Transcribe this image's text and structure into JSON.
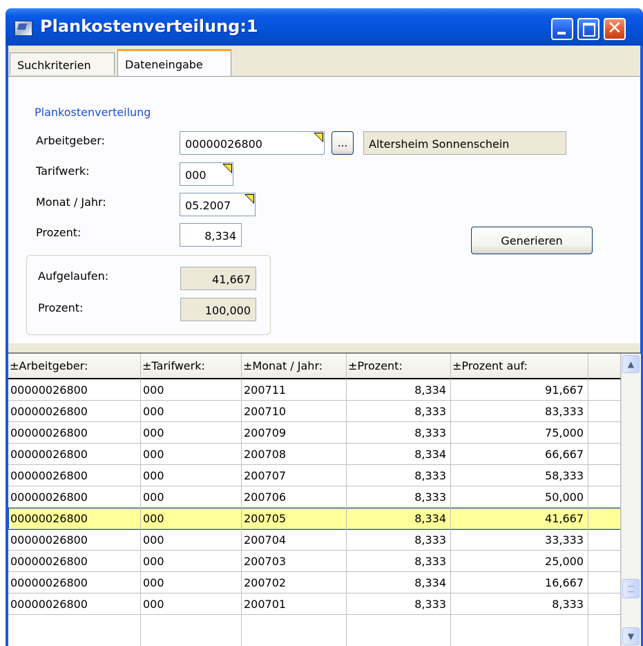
{
  "window": {
    "title": "Plankostenverteilung:1"
  },
  "tabs": [
    {
      "label": "Suchkriterien"
    },
    {
      "label": "Dateneingabe",
      "active": true
    }
  ],
  "form": {
    "section_title": "Plankostenverteilung",
    "arbeitgeber": {
      "label": "Arbeitgeber:",
      "value": "00000026800",
      "lookup_label": "...",
      "name": "Altersheim Sonnenschein"
    },
    "tarifwerk": {
      "label": "Tarifwerk:",
      "value": "000"
    },
    "monat_jahr": {
      "label": "Monat / Jahr:",
      "value": "05.2007"
    },
    "prozent": {
      "label": "Prozent:",
      "value": "8,334"
    },
    "generate_label": "Generieren",
    "summary": {
      "aufgelaufen_label": "Aufgelaufen:",
      "aufgelaufen_value": "41,667",
      "prozent_label": "Prozent:",
      "prozent_value": "100,000"
    }
  },
  "grid": {
    "columns": [
      "±Arbeitgeber:",
      "±Tarifwerk:",
      "±Monat / Jahr:",
      "±Prozent:",
      "±Prozent auf:"
    ],
    "rows": [
      [
        "00000026800",
        "000",
        "200711",
        "8,334",
        "91,667"
      ],
      [
        "00000026800",
        "000",
        "200710",
        "8,333",
        "83,333"
      ],
      [
        "00000026800",
        "000",
        "200709",
        "8,333",
        "75,000"
      ],
      [
        "00000026800",
        "000",
        "200708",
        "8,334",
        "66,667"
      ],
      [
        "00000026800",
        "000",
        "200707",
        "8,333",
        "58,333"
      ],
      [
        "00000026800",
        "000",
        "200706",
        "8,333",
        "50,000"
      ],
      [
        "00000026800",
        "000",
        "200705",
        "8,334",
        "41,667"
      ],
      [
        "00000026800",
        "000",
        "200704",
        "8,333",
        "33,333"
      ],
      [
        "00000026800",
        "000",
        "200703",
        "8,333",
        "25,000"
      ],
      [
        "00000026800",
        "000",
        "200702",
        "8,334",
        "16,667"
      ],
      [
        "00000026800",
        "000",
        "200701",
        "8,333",
        "8,333"
      ]
    ],
    "selected_row": 6,
    "selected_color": "#ffff99"
  },
  "colors": {
    "titlebar": "#0351d6",
    "accent": "#1d4fd6",
    "tab_highlight": "#f5a42a"
  }
}
